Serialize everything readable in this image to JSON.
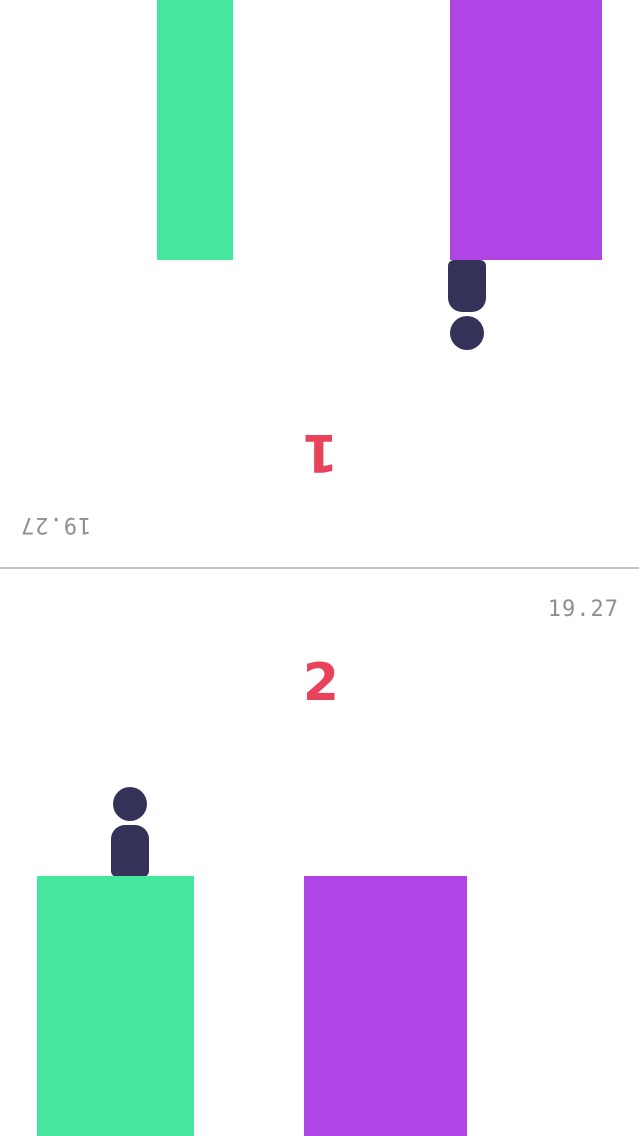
{
  "colors": {
    "background": "#ffffff",
    "green": "#45e69e",
    "purple": "#b045e6",
    "player": "#35325a",
    "score": "#e8435a",
    "timer": "#8f8f8f",
    "divider": "#c4c4c4"
  },
  "top_player": {
    "score": "1",
    "timer": "19.27",
    "orientation": "upside-down",
    "pillars": [
      "green",
      "purple"
    ],
    "character_on": "purple"
  },
  "bottom_player": {
    "score": "2",
    "timer": "19.27",
    "orientation": "upright",
    "pillars": [
      "green",
      "purple"
    ],
    "character_on": "green"
  },
  "icons": {
    "character": "pawn-character-icon"
  }
}
